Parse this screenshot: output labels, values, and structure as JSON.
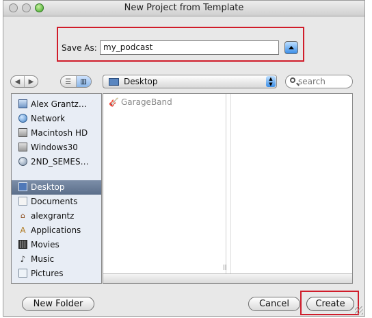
{
  "window": {
    "title": "New Project from Template"
  },
  "save_as": {
    "label": "Save As:",
    "value": "my_podcast"
  },
  "toolbar": {
    "back_icon": "◀",
    "forward_icon": "▶",
    "list_view_icon": "☰",
    "column_view_icon": "▥",
    "location": "Desktop",
    "search_placeholder": "search"
  },
  "sidebar": {
    "items": [
      {
        "label": "Alex Grantz…",
        "icon": "computer-icon"
      },
      {
        "label": "Network",
        "icon": "globe-icon"
      },
      {
        "label": "Macintosh HD",
        "icon": "hard-disk-icon"
      },
      {
        "label": "Windows30",
        "icon": "hard-disk-icon"
      },
      {
        "label": "2ND_SEMES…",
        "icon": "network-volume-icon"
      },
      {
        "label": "Desktop",
        "icon": "desktop-icon",
        "selected": true
      },
      {
        "label": "Documents",
        "icon": "document-icon"
      },
      {
        "label": "alexgrantz",
        "icon": "home-icon"
      },
      {
        "label": "Applications",
        "icon": "applications-icon"
      },
      {
        "label": "Movies",
        "icon": "movies-icon"
      },
      {
        "label": "Music",
        "icon": "music-icon"
      },
      {
        "label": "Pictures",
        "icon": "pictures-icon"
      }
    ]
  },
  "browser": {
    "column1": [
      {
        "label": "GarageBand",
        "icon": "guitar-icon",
        "dimmed": true
      }
    ]
  },
  "buttons": {
    "new_folder": "New Folder",
    "cancel": "Cancel",
    "create": "Create"
  },
  "colors": {
    "highlight_box": "#d01c2a",
    "sidebar_selection": "#6a7c98"
  }
}
